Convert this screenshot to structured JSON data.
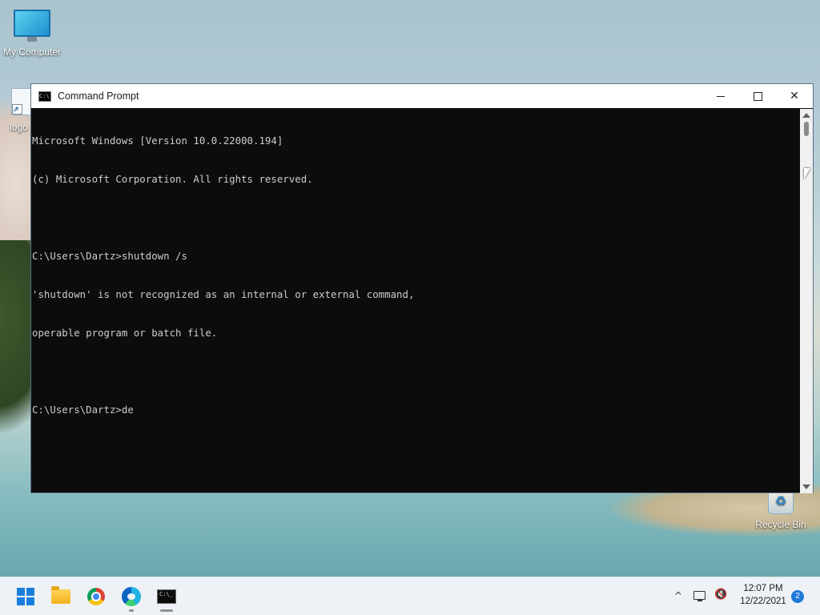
{
  "desktop": {
    "icons": [
      {
        "label": "My Computer",
        "icon": "monitor-icon"
      },
      {
        "label": "logo",
        "icon": "shortcut-icon"
      },
      {
        "label": "Recycle Bin",
        "icon": "recycle-bin-icon"
      }
    ]
  },
  "window": {
    "title": "Command Prompt",
    "icon": "cmd-icon",
    "minimize_label": "minimize",
    "maximize_label": "maximize",
    "close_label": "✕"
  },
  "console": {
    "lines": [
      "Microsoft Windows [Version 10.0.22000.194]",
      "(c) Microsoft Corporation. All rights reserved.",
      "",
      "C:\\Users\\Dartz>shutdown /s",
      "'shutdown' is not recognized as an internal or external command,",
      "operable program or batch file.",
      "",
      "C:\\Users\\Dartz>de"
    ]
  },
  "taskbar": {
    "apps": [
      {
        "name": "Start",
        "icon": "windows-start-icon"
      },
      {
        "name": "File Explorer",
        "icon": "folder-icon"
      },
      {
        "name": "Google Chrome",
        "icon": "chrome-icon"
      },
      {
        "name": "Microsoft Edge",
        "icon": "edge-icon"
      },
      {
        "name": "Command Prompt",
        "icon": "cmd-icon"
      }
    ],
    "tray": {
      "chevron": "^",
      "time": "12:07 PM",
      "date": "12/22/2021",
      "notification_count": "2"
    }
  },
  "colors": {
    "console_bg": "#0c0c0c",
    "console_fg": "#cccccc",
    "accent": "#1a7fdc"
  }
}
